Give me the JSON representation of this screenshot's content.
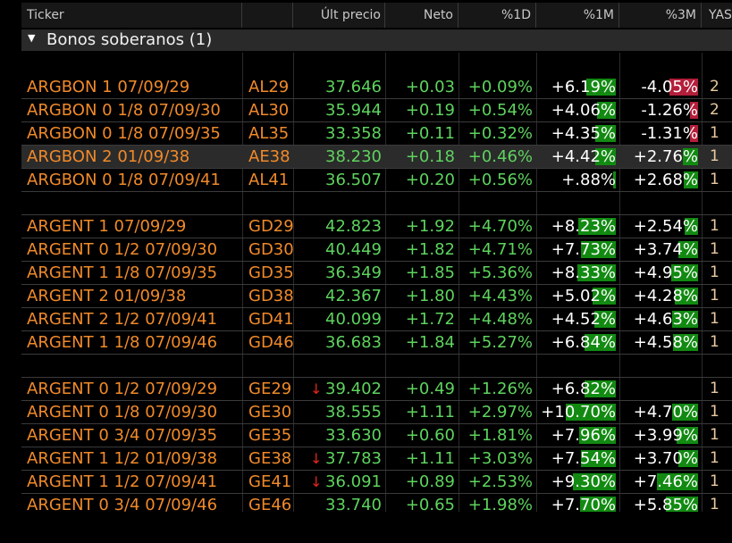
{
  "header": {
    "ticker": "Ticker",
    "last_price": "Últ precio",
    "net": "Neto",
    "pct_1d": "%1D",
    "pct_1m": "%1M",
    "pct_3m": "%3M",
    "yas": "YAS"
  },
  "group": {
    "label": "Bonos soberanos (1)"
  },
  "rows": [
    {
      "ticker": "ARGBON 1 07/09/29",
      "code": "AL29",
      "price": "37.646",
      "net": "+0.03",
      "d1": "+0.09%",
      "m1": "+6.19%",
      "m3": "-4.05%",
      "yas": "2",
      "m1_fill": 0.35,
      "m3_fill": 0.35,
      "m3_neg": true
    },
    {
      "ticker": "ARGBON 0 1/8 07/09/30",
      "code": "AL30",
      "price": "35.944",
      "net": "+0.19",
      "d1": "+0.54%",
      "m1": "+4.06%",
      "m3": "-1.26%",
      "yas": "2",
      "m1_fill": 0.23,
      "m3_fill": 0.1,
      "m3_neg": true
    },
    {
      "ticker": "ARGBON 0 1/8 07/09/35",
      "code": "AL35",
      "price": "33.358",
      "net": "+0.11",
      "d1": "+0.32%",
      "m1": "+4.35%",
      "m3": "-1.31%",
      "yas": "1",
      "m1_fill": 0.25,
      "m3_fill": 0.1,
      "m3_neg": true
    },
    {
      "ticker": "ARGBON 2 01/09/38",
      "code": "AE38",
      "price": "38.230",
      "net": "+0.18",
      "d1": "+0.46%",
      "m1": "+4.42%",
      "m3": "+2.76%",
      "yas": "1",
      "m1_fill": 0.25,
      "m3_fill": 0.18,
      "selected": true
    },
    {
      "ticker": "ARGBON 0 1/8 07/09/41",
      "code": "AL41",
      "price": "36.507",
      "net": "+0.20",
      "d1": "+0.56%",
      "m1": "+.88%",
      "m3": "+2.68%",
      "yas": "1",
      "m1_fill": 0.03,
      "m3_fill": 0.17
    },
    {
      "spacer": true
    },
    {
      "ticker": "ARGENT 1 07/09/29",
      "code": "GD29",
      "price": "42.823",
      "net": "+1.92",
      "d1": "+4.70%",
      "m1": "+8.23%",
      "m3": "+2.54%",
      "yas": "1",
      "m1_fill": 0.45,
      "m3_fill": 0.16
    },
    {
      "ticker": "ARGENT 0 1/2 07/09/30",
      "code": "GD30",
      "price": "40.449",
      "net": "+1.82",
      "d1": "+4.71%",
      "m1": "+7.73%",
      "m3": "+3.74%",
      "yas": "1",
      "m1_fill": 0.42,
      "m3_fill": 0.24
    },
    {
      "ticker": "ARGENT 1 1/8 07/09/35",
      "code": "GD35",
      "price": "36.349",
      "net": "+1.85",
      "d1": "+5.36%",
      "m1": "+8.33%",
      "m3": "+4.95%",
      "yas": "1",
      "m1_fill": 0.46,
      "m3_fill": 0.33
    },
    {
      "ticker": "ARGENT 2 01/09/38",
      "code": "GD38",
      "price": "42.367",
      "net": "+1.80",
      "d1": "+4.43%",
      "m1": "+5.02%",
      "m3": "+4.28%",
      "yas": "1",
      "m1_fill": 0.28,
      "m3_fill": 0.28
    },
    {
      "ticker": "ARGENT 2 1/2 07/09/41",
      "code": "GD41",
      "price": "40.099",
      "net": "+1.72",
      "d1": "+4.48%",
      "m1": "+4.52%",
      "m3": "+4.63%",
      "yas": "1",
      "m1_fill": 0.26,
      "m3_fill": 0.31
    },
    {
      "ticker": "ARGENT 1 1/8 07/09/46",
      "code": "GD46",
      "price": "36.683",
      "net": "+1.84",
      "d1": "+5.27%",
      "m1": "+6.84%",
      "m3": "+4.58%",
      "yas": "1",
      "m1_fill": 0.38,
      "m3_fill": 0.3
    },
    {
      "spacer": true
    },
    {
      "ticker": "ARGENT 0 1/2 07/09/29",
      "code": "GE29",
      "price": "39.402",
      "net": "+0.49",
      "d1": "+1.26%",
      "m1": "+6.82%",
      "m3": "",
      "yas": "1",
      "m1_fill": 0.38,
      "m3_fill": 0,
      "down": true
    },
    {
      "ticker": "ARGENT 0 1/8 07/09/30",
      "code": "GE30",
      "price": "38.555",
      "net": "+1.11",
      "d1": "+2.97%",
      "m1": "+10.70%",
      "m3": "+4.70%",
      "yas": "1",
      "m1_fill": 0.6,
      "m3_fill": 0.31
    },
    {
      "ticker": "ARGENT 0 3/4 07/09/35",
      "code": "GE35",
      "price": "33.630",
      "net": "+0.60",
      "d1": "+1.81%",
      "m1": "+7.96%",
      "m3": "+3.99%",
      "yas": "1",
      "m1_fill": 0.44,
      "m3_fill": 0.26
    },
    {
      "ticker": "ARGENT 1 1/2 01/09/38",
      "code": "GE38",
      "price": "37.783",
      "net": "+1.11",
      "d1": "+3.03%",
      "m1": "+7.54%",
      "m3": "+3.70%",
      "yas": "1",
      "m1_fill": 0.42,
      "m3_fill": 0.24,
      "down": true
    },
    {
      "ticker": "ARGENT 1 1/2 07/09/41",
      "code": "GE41",
      "price": "36.091",
      "net": "+0.89",
      "d1": "+2.53%",
      "m1": "+9.30%",
      "m3": "+7.46%",
      "yas": "1",
      "m1_fill": 0.52,
      "m3_fill": 0.5,
      "down": true
    },
    {
      "ticker": "ARGENT 0 3/4 07/09/46",
      "code": "GE46",
      "price": "33.740",
      "net": "+0.65",
      "d1": "+1.98%",
      "m1": "+7.70%",
      "m3": "+5.85%",
      "yas": "1",
      "m1_fill": 0.43,
      "m3_fill": 0.39
    }
  ],
  "icons": {
    "group_toggle": "caret-down-icon",
    "down_arrow": "down-arrow-icon"
  },
  "colors": {
    "ticker": "#f08a2a",
    "positive": "#5ed35e",
    "bar_green": "#128a12",
    "bar_red": "#b31e3a"
  }
}
